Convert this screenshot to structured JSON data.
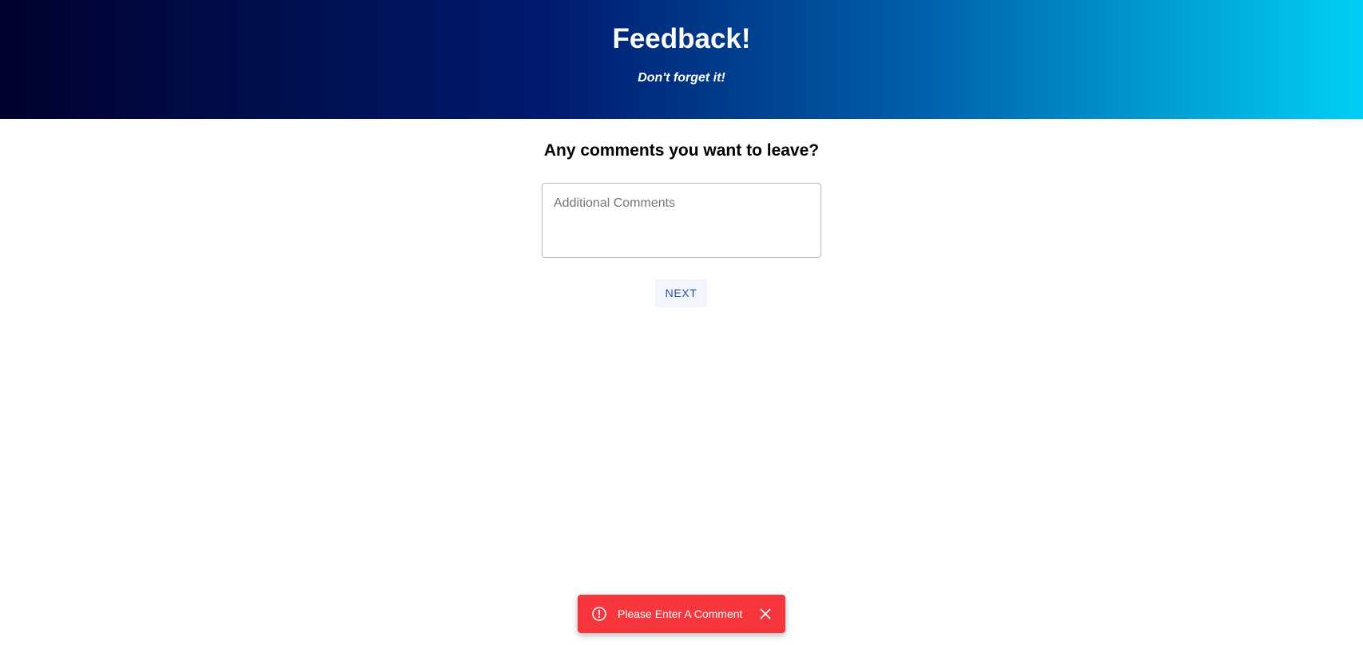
{
  "header": {
    "title": "Feedback!",
    "subtitle": "Don't forget it!",
    "gradient_colors": [
      "#00022e",
      "#001a6e",
      "#0061ad",
      "#00a6d8",
      "#00cff6"
    ]
  },
  "form": {
    "question": "Any comments you want to leave?",
    "comment_value": "",
    "comment_placeholder": "Additional Comments",
    "next_label": "NEXT",
    "next_color": "#2b4fa8"
  },
  "toast": {
    "severity": "error",
    "color": "#f6363c",
    "icon": "error-outline-icon",
    "message": "Please Enter A Comment",
    "close_icon": "close-icon"
  }
}
